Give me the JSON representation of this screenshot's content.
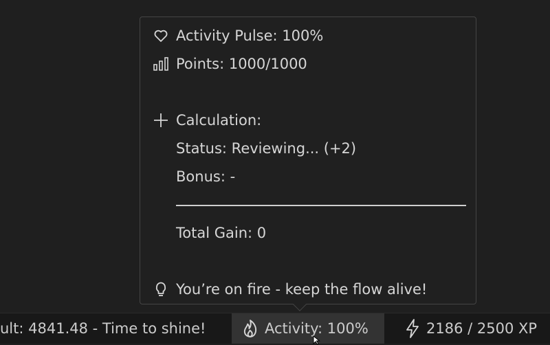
{
  "hover": {
    "pulse_text": "Activity Pulse: 100%",
    "points_text": "Points: 1000/1000",
    "calculation_label": "Calculation:",
    "status_text": "Status: Reviewing... (+2)",
    "bonus_text": "Bonus: -",
    "total_text": "Total Gain: 0",
    "tip_text": "You’re on fire - keep the flow alive!"
  },
  "statusbar": {
    "result_text": "ult: 4841.48 - Time to shine!",
    "activity_text": "Activity: 100%",
    "xp_text": "2186 / 2500 XP"
  },
  "icons": {
    "pulse": "heart-icon",
    "points": "bar-chart-icon",
    "calculation": "plus-icon",
    "tip": "lightbulb-icon",
    "activity": "flame-icon",
    "xp": "lightning-icon"
  },
  "colors": {
    "background": "#1f1f1f",
    "hover_background": "#202020",
    "hover_border": "#454545",
    "statusbar_background": "#181818",
    "active_item_background": "#333333",
    "text": "#d4d4d4"
  }
}
